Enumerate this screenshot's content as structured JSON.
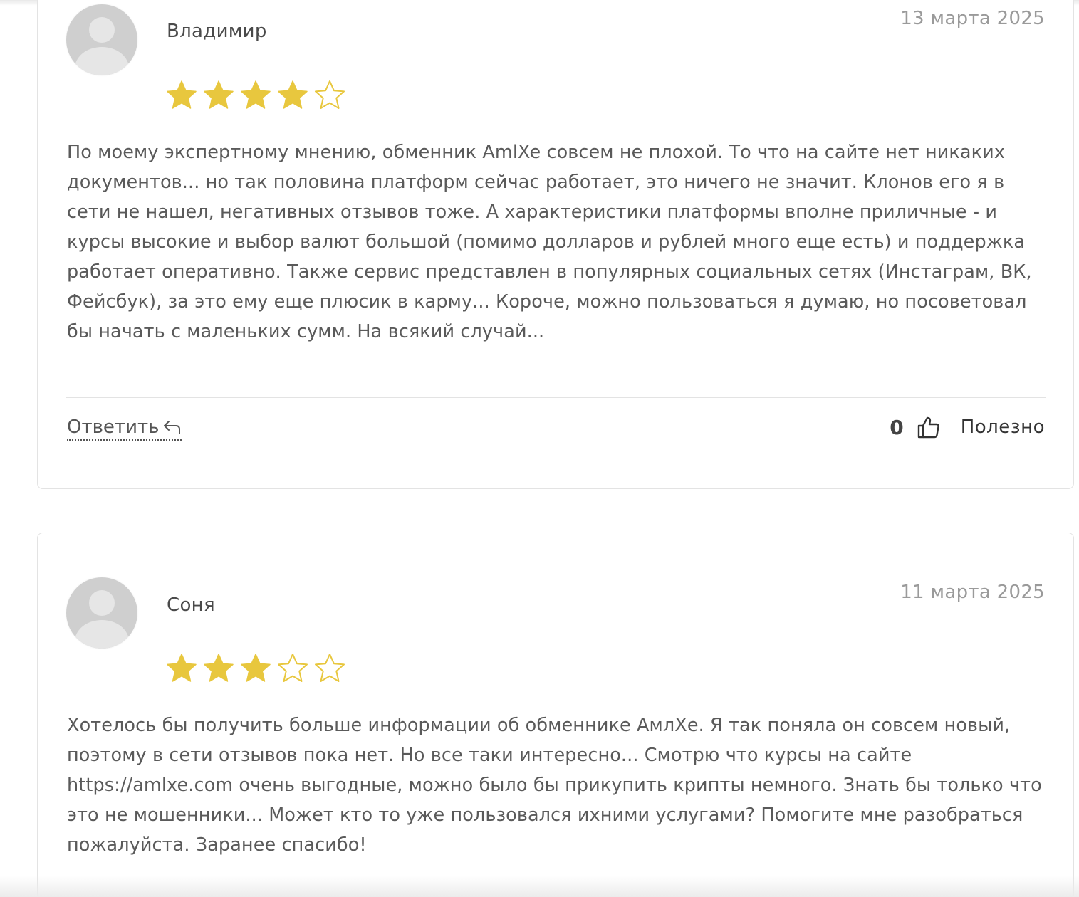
{
  "reviews": [
    {
      "author": "Владимир",
      "date": "13 марта 2025",
      "rating": 4,
      "rating_max": 5,
      "text": "По моему экспертному мнению, обменник AmlXe совсем не плохой. То что на сайте нет никаких документов... но так половина платформ сейчас работает, это ничего не значит. Клонов его я в сети не нашел, негативных отзывов тоже. А характеристики платформы вполне приличные - и курсы высокие и выбор валют большой (помимо долларов и рублей много еще есть) и поддержка работает оперативно. Также сервис представлен в популярных социальных сетях (Инстаграм, ВК, Фейсбук), за это ему еще плюсик в карму... Короче, можно пользоваться я думаю, но посоветовал бы начать с маленьких сумм. На всякий случай...",
      "reply_label": "Ответить",
      "helpful_count": "0",
      "helpful_label": "Полезно"
    },
    {
      "author": "Соня",
      "date": "11 марта 2025",
      "rating": 3,
      "rating_max": 5,
      "text": "Хотелось бы получить больше информации об обменнике АмлХе. Я так поняла он совсем новый, поэтому в сети отзывов пока нет. Но все таки интересно... Смотрю что курсы на сайте https://amlxe.com очень выгодные, можно было бы прикупить крипты немного. Знать бы только что это не мошенники... Может кто то уже пользовался ихними услугами? Помогите мне разобраться пожалуйста. Заранее спасибо!"
    }
  ],
  "colors": {
    "star_filled": "#E8C73E",
    "star_empty_stroke": "#E8C73E",
    "border": "#E3E3E3",
    "avatar_bg": "#CFCFCF"
  },
  "icons": {
    "reply": "reply-arrow-icon",
    "helpful": "thumbs-up-icon"
  }
}
